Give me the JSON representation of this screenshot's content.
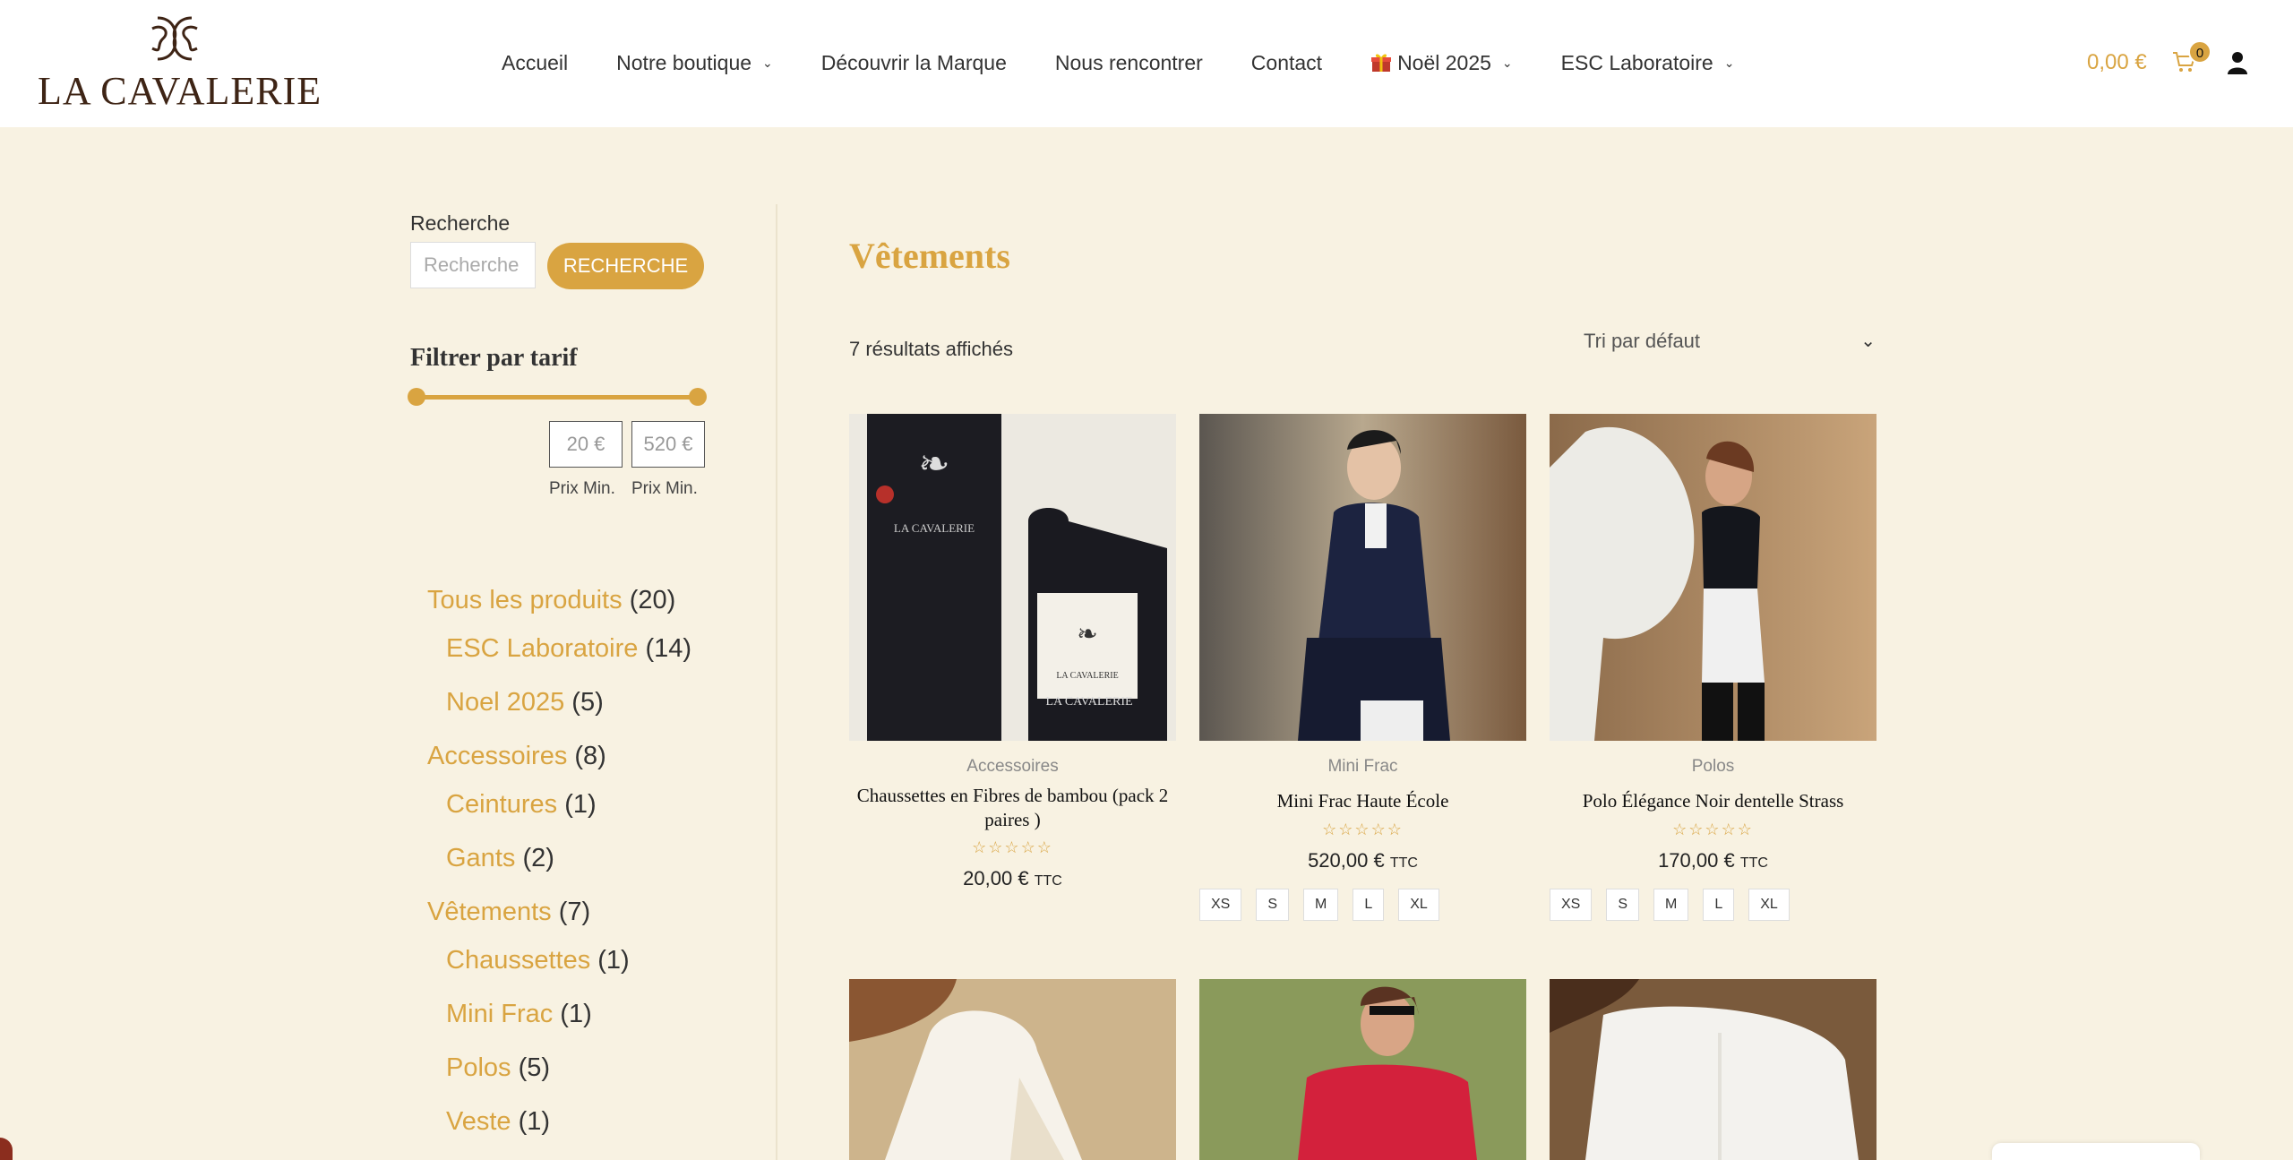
{
  "header": {
    "logo_text": "LA CAVALERIE",
    "nav": [
      {
        "label": "Accueil",
        "dropdown": false
      },
      {
        "label": "Notre boutique",
        "dropdown": true
      },
      {
        "label": "Découvrir la Marque",
        "dropdown": false
      },
      {
        "label": "Nous rencontrer",
        "dropdown": false
      },
      {
        "label": "Contact",
        "dropdown": false
      },
      {
        "label": "Noël 2025",
        "dropdown": true,
        "icon": "gift-icon"
      },
      {
        "label": "ESC Laboratoire",
        "dropdown": true
      }
    ],
    "cart_total": "0,00 €",
    "cart_count": "0"
  },
  "sidebar": {
    "search_label": "Recherche",
    "search_placeholder": "Recherche",
    "search_button": "Recherche",
    "filter_title": "Filtrer par tarif",
    "price_min": "20 €",
    "price_max": "520 €",
    "price_min_label": "Prix Min.",
    "price_max_label": "Prix Min.",
    "categories": [
      {
        "name": "Tous les produits",
        "count": "(20)",
        "level": 0
      },
      {
        "name": "ESC Laboratoire",
        "count": "(14)",
        "level": 1
      },
      {
        "name": "Noel 2025",
        "count": "(5)",
        "level": 1
      },
      {
        "name": "Accessoires",
        "count": "(8)",
        "level": 0
      },
      {
        "name": "Ceintures",
        "count": "(1)",
        "level": 1
      },
      {
        "name": "Gants",
        "count": "(2)",
        "level": 1
      },
      {
        "name": "Vêtements",
        "count": "(7)",
        "level": 0
      },
      {
        "name": "Chaussettes",
        "count": "(1)",
        "level": 1
      },
      {
        "name": "Mini Frac",
        "count": "(1)",
        "level": 1
      },
      {
        "name": "Polos",
        "count": "(5)",
        "level": 1
      },
      {
        "name": "Veste",
        "count": "(1)",
        "level": 1
      }
    ]
  },
  "main": {
    "title": "Vêtements",
    "result_count": "7 résultats affichés",
    "sort_label": "Tri par défaut",
    "products": [
      {
        "category": "Accessoires",
        "name": "Chaussettes en Fibres de bambou (pack 2 paires )",
        "price": "20,00 €",
        "price_suffix": "TTC",
        "sizes": []
      },
      {
        "category": "Mini Frac",
        "name": "Mini Frac Haute École",
        "price": "520,00 €",
        "price_suffix": "TTC",
        "sizes": [
          "XS",
          "S",
          "M",
          "L",
          "XL"
        ]
      },
      {
        "category": "Polos",
        "name": "Polo Élégance Noir dentelle Strass",
        "price": "170,00 €",
        "price_suffix": "TTC",
        "sizes": [
          "XS",
          "S",
          "M",
          "L",
          "XL"
        ]
      }
    ],
    "stars_text": "☆☆☆☆☆"
  },
  "colors": {
    "accent": "#d9a441",
    "background": "#f8f2e2",
    "logo": "#3e2415"
  }
}
